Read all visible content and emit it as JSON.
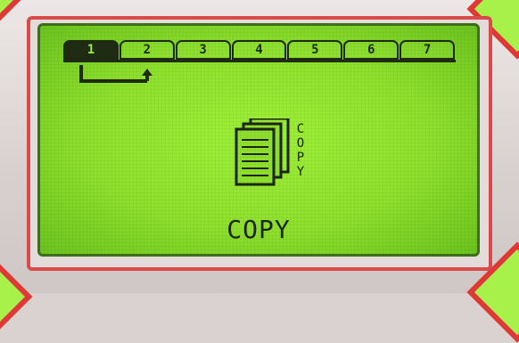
{
  "display": {
    "tabs": [
      {
        "label": "1",
        "active": true
      },
      {
        "label": "2",
        "active": false
      },
      {
        "label": "3",
        "active": false
      },
      {
        "label": "4",
        "active": false
      },
      {
        "label": "5",
        "active": false
      },
      {
        "label": "6",
        "active": false
      },
      {
        "label": "7",
        "active": false
      }
    ],
    "mode_label": "COPY",
    "icon_side_text": "COPY",
    "icon": "copy-documents-icon"
  },
  "colors": {
    "lcd_background": "#9ff03a",
    "lcd_ink": "#1a2410",
    "bezel": "#d94a4a"
  }
}
